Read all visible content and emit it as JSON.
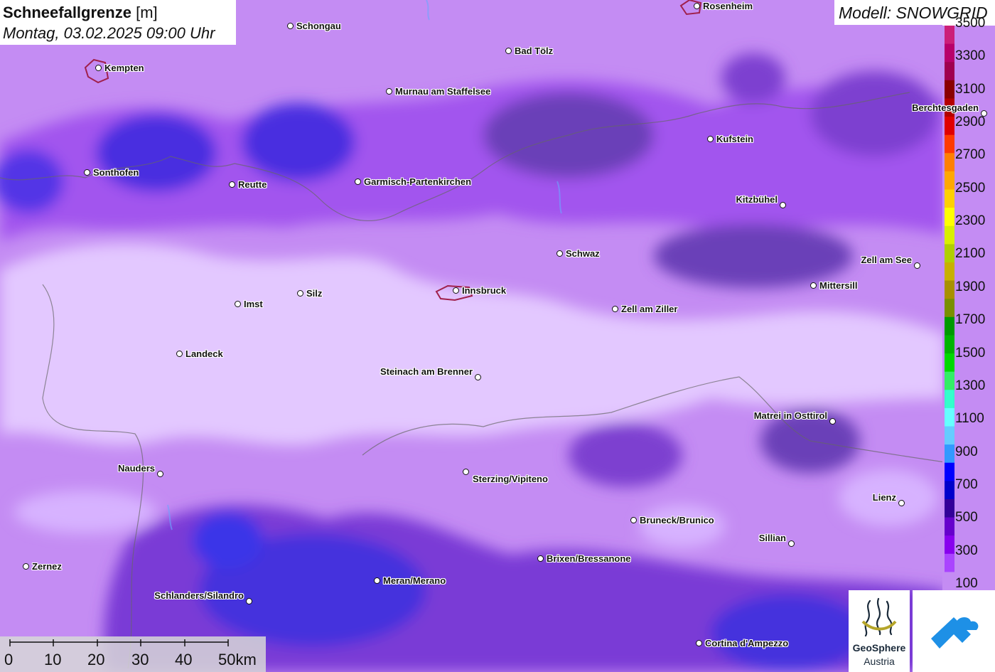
{
  "title": {
    "parameter": "Schneefallgrenze",
    "unit": "[m]",
    "datetime": "Montag, 03.02.2025 09:00 Uhr"
  },
  "model": "Modell: SNOWGRID",
  "legend": {
    "labels": [
      "3500",
      "3300",
      "3100",
      "2900",
      "2700",
      "2500",
      "2300",
      "2100",
      "1900",
      "1700",
      "1500",
      "1300",
      "1100",
      "900",
      "700",
      "500",
      "300",
      "100"
    ],
    "colors": [
      "#cc1f78",
      "#b8006a",
      "#a0004f",
      "#8a0000",
      "#b30000",
      "#e00000",
      "#ff3a00",
      "#ff8000",
      "#ffa800",
      "#ffd000",
      "#ffff00",
      "#d9ef00",
      "#b0cf00",
      "#c8b000",
      "#a89000",
      "#7a8f00",
      "#009900",
      "#00b400",
      "#00d800",
      "#33ee66",
      "#33ffcc",
      "#66ffff",
      "#66ccff",
      "#3399ff",
      "#0000ff",
      "#0000cc",
      "#330099",
      "#6600cc",
      "#8800ee",
      "#aa44ff",
      "#c48cf3"
    ]
  },
  "scale": {
    "labels": [
      "0",
      "10",
      "20",
      "30",
      "40",
      "50km"
    ]
  },
  "logos": {
    "geosphere_line1": "GeoSphere",
    "geosphere_line2": "Austria",
    "geosphere_icon": "geosphere-swirl-icon",
    "app_icon": "cloud-arrow-icon"
  },
  "cities": [
    {
      "name": "Rosenheim"
    },
    {
      "name": "Schongau"
    },
    {
      "name": "Bad Tölz"
    },
    {
      "name": "Kempten"
    },
    {
      "name": "Murnau am Staffelsee"
    },
    {
      "name": "Berchtesgaden"
    },
    {
      "name": "Kufstein"
    },
    {
      "name": "Sonthofen"
    },
    {
      "name": "Reutte"
    },
    {
      "name": "Garmisch-Partenkirchen"
    },
    {
      "name": "Kitzbühel"
    },
    {
      "name": "Schwaz"
    },
    {
      "name": "Zell am See"
    },
    {
      "name": "Mittersill"
    },
    {
      "name": "Innsbruck"
    },
    {
      "name": "Silz"
    },
    {
      "name": "Imst"
    },
    {
      "name": "Zell am Ziller"
    },
    {
      "name": "Landeck"
    },
    {
      "name": "Steinach am Brenner"
    },
    {
      "name": "Matrei in Osttirol"
    },
    {
      "name": "Nauders"
    },
    {
      "name": "Sterzing/Vipiteno"
    },
    {
      "name": "Lienz"
    },
    {
      "name": "Bruneck/Brunico"
    },
    {
      "name": "Sillian"
    },
    {
      "name": "Brixen/Bressanone"
    },
    {
      "name": "Zernez"
    },
    {
      "name": "Meran/Merano"
    },
    {
      "name": "Schlanders/Silandro"
    },
    {
      "name": "Cortina d'Ampezzo"
    }
  ]
}
